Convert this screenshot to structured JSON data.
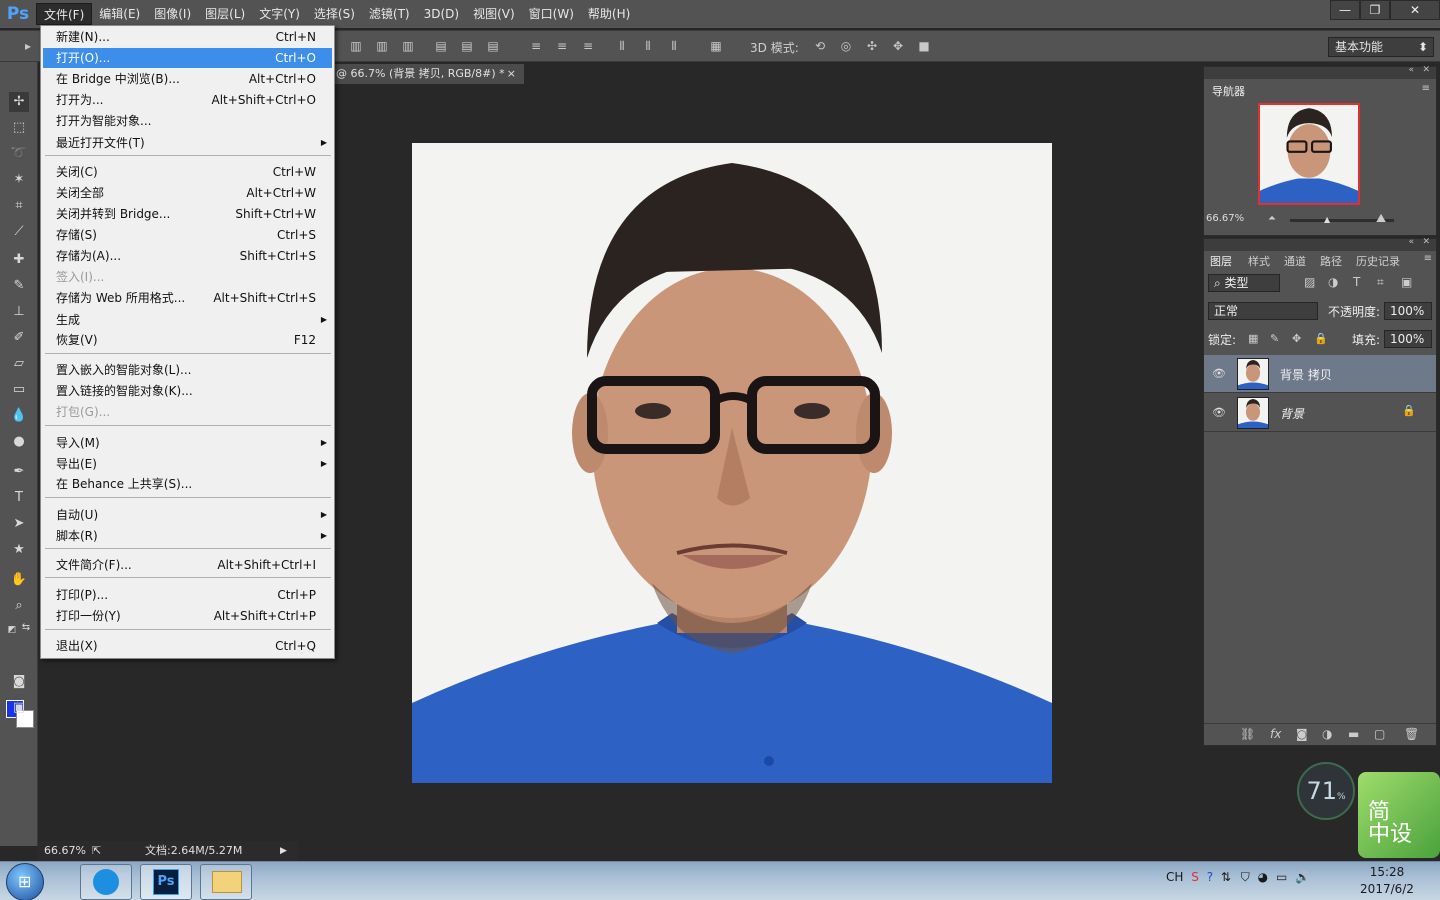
{
  "app": {
    "logo": "Ps"
  },
  "menubar": [
    "文件(F)",
    "编辑(E)",
    "图像(I)",
    "图层(L)",
    "文字(Y)",
    "选择(S)",
    "滤镜(T)",
    "3D(D)",
    "视图(V)",
    "窗口(W)",
    "帮助(H)"
  ],
  "window_controls": {
    "minimize": "—",
    "restore": "❐",
    "close": "✕"
  },
  "options_bar": {
    "mode_3d_label": "3D 模式:",
    "workspace": "基本功能"
  },
  "document_tab": {
    "title": "@ 66.7% (背景 拷贝, RGB/8#) *",
    "close": "×"
  },
  "file_menu": {
    "items": [
      {
        "label": "新建(N)...",
        "shortcut": "Ctrl+N"
      },
      {
        "label": "打开(O)...",
        "shortcut": "Ctrl+O",
        "highlighted": true
      },
      {
        "label": "在 Bridge 中浏览(B)...",
        "shortcut": "Alt+Ctrl+O"
      },
      {
        "label": "打开为...",
        "shortcut": "Alt+Shift+Ctrl+O"
      },
      {
        "label": "打开为智能对象...",
        "shortcut": ""
      },
      {
        "label": "最近打开文件(T)",
        "shortcut": "",
        "submenu": true
      },
      {
        "label": "关闭(C)",
        "shortcut": "Ctrl+W"
      },
      {
        "label": "关闭全部",
        "shortcut": "Alt+Ctrl+W"
      },
      {
        "label": "关闭并转到 Bridge...",
        "shortcut": "Shift+Ctrl+W"
      },
      {
        "label": "存储(S)",
        "shortcut": "Ctrl+S"
      },
      {
        "label": "存储为(A)...",
        "shortcut": "Shift+Ctrl+S"
      },
      {
        "label": "签入(I)...",
        "shortcut": "",
        "disabled": true
      },
      {
        "label": "存储为 Web 所用格式...",
        "shortcut": "Alt+Shift+Ctrl+S"
      },
      {
        "label": "生成",
        "shortcut": "",
        "submenu": true
      },
      {
        "label": "恢复(V)",
        "shortcut": "F12"
      },
      {
        "label": "置入嵌入的智能对象(L)...",
        "shortcut": ""
      },
      {
        "label": "置入链接的智能对象(K)...",
        "shortcut": ""
      },
      {
        "label": "打包(G)...",
        "shortcut": "",
        "disabled": true
      },
      {
        "label": "导入(M)",
        "shortcut": "",
        "submenu": true
      },
      {
        "label": "导出(E)",
        "shortcut": "",
        "submenu": true
      },
      {
        "label": "在 Behance 上共享(S)...",
        "shortcut": ""
      },
      {
        "label": "自动(U)",
        "shortcut": "",
        "submenu": true
      },
      {
        "label": "脚本(R)",
        "shortcut": "",
        "submenu": true
      },
      {
        "label": "文件简介(F)...",
        "shortcut": "Alt+Shift+Ctrl+I"
      },
      {
        "label": "打印(P)...",
        "shortcut": "Ctrl+P"
      },
      {
        "label": "打印一份(Y)",
        "shortcut": "Alt+Shift+Ctrl+P"
      },
      {
        "label": "退出(X)",
        "shortcut": "Ctrl+Q"
      }
    ]
  },
  "navigator": {
    "title": "导航器",
    "zoom": "66.67%"
  },
  "layers_panel": {
    "tabs": [
      "图层",
      "样式",
      "通道",
      "路径",
      "历史记录"
    ],
    "filter_kind": "类型",
    "blend_mode": "正常",
    "opacity_label": "不透明度:",
    "opacity": "100%",
    "lock_label": "锁定:",
    "fill_label": "填充:",
    "fill": "100%",
    "layers": [
      {
        "name": "背景 拷贝",
        "selected": true
      },
      {
        "name": "背景",
        "locked": true
      }
    ]
  },
  "status_bar": {
    "zoom": "66.67%",
    "doc_info": "文档:2.64M/5.27M"
  },
  "taskbar": {
    "ps_label": "Ps",
    "tray_lang": "CH",
    "time": "15:28",
    "date": "2017/6/2"
  },
  "widgets": {
    "speed": "71",
    "speed_unit": "%",
    "jianzhong": "简\n中设"
  },
  "colors": {
    "foreground": "#1a35e6",
    "background": "#ffffff",
    "highlight": "#3c8eea"
  }
}
